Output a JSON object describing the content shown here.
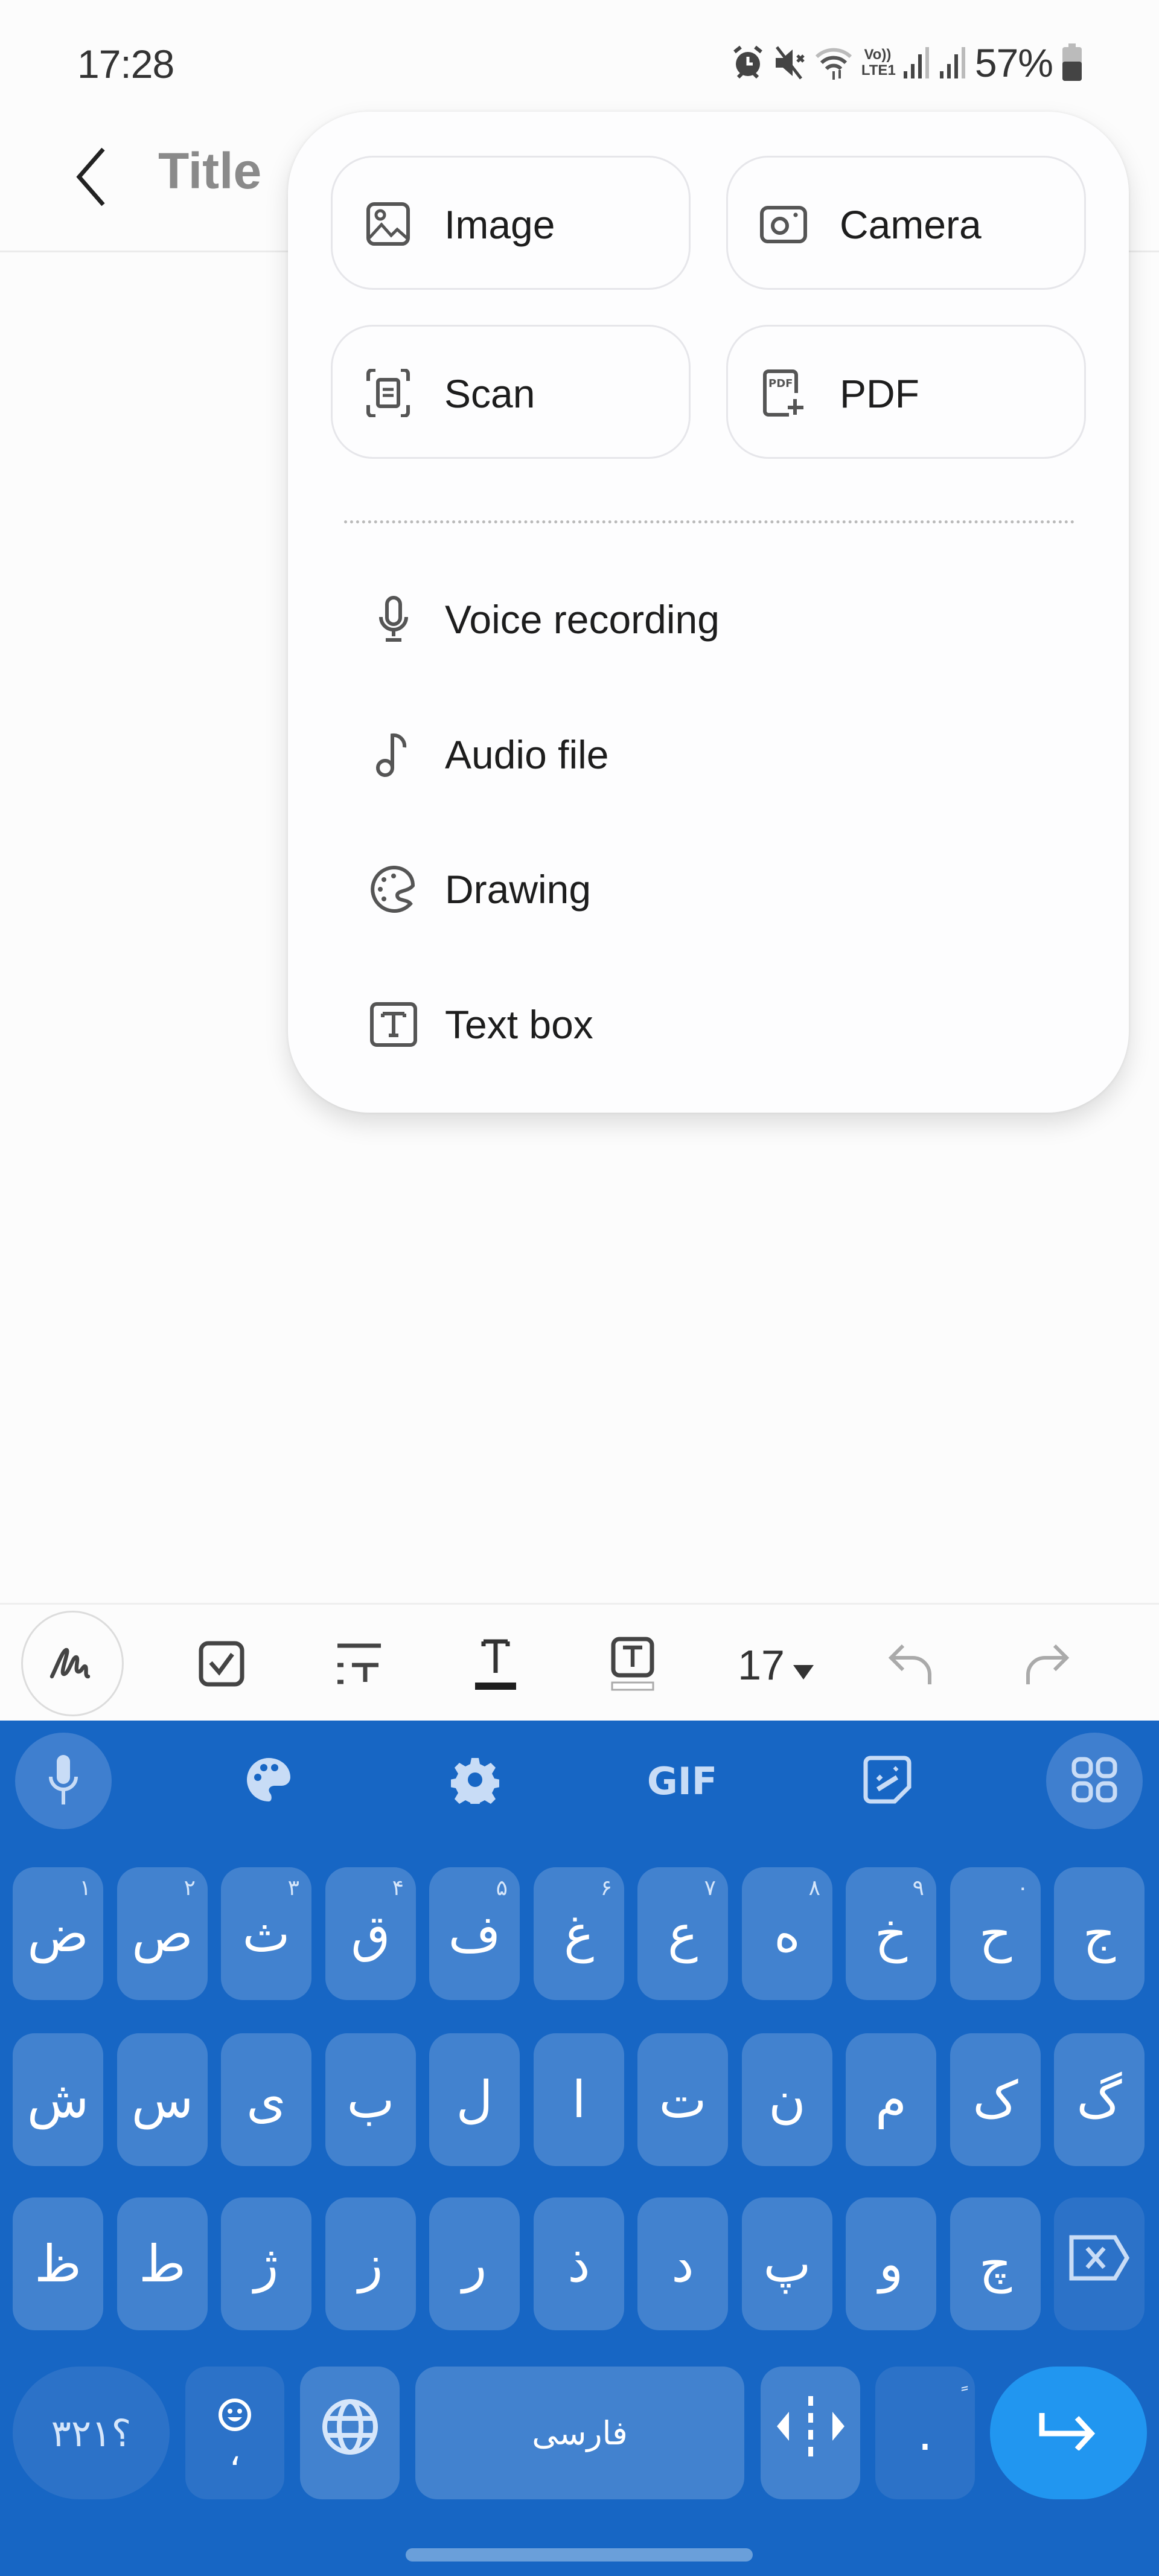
{
  "status_bar": {
    "time": "17:28",
    "icons": [
      "alarm-icon",
      "mute-icon",
      "wifi-icon",
      "volte-lte-icon",
      "signal-icon",
      "signal-icon"
    ],
    "volte_label": "Vo)) LTE1",
    "battery_percent": "57%",
    "battery_level": 0.57
  },
  "header": {
    "back_icon": "chevron-left-icon",
    "title_placeholder": "Title"
  },
  "insert_menu": {
    "grid": [
      {
        "label": "Image",
        "icon": "image-icon"
      },
      {
        "label": "Camera",
        "icon": "camera-icon"
      },
      {
        "label": "Scan",
        "icon": "scan-icon"
      },
      {
        "label": "PDF",
        "icon": "pdf-add-icon"
      }
    ],
    "list": [
      {
        "label": "Voice recording",
        "icon": "microphone-icon"
      },
      {
        "label": "Audio file",
        "icon": "music-note-icon"
      },
      {
        "label": "Drawing",
        "icon": "palette-icon"
      },
      {
        "label": "Text box",
        "icon": "text-box-icon"
      }
    ]
  },
  "editor_toolbar": {
    "items": [
      "handwriting-icon",
      "checkbox-icon",
      "paragraph-style-icon",
      "text-color-icon",
      "text-box-highlight-icon",
      "font-size-dropdown",
      "undo-icon",
      "redo-icon"
    ],
    "font_size": "17"
  },
  "keyboard": {
    "accent_color": "#1766c4",
    "key_color": "#4282cf",
    "enter_color": "#2196f0",
    "toolbar": [
      "microphone-icon",
      "palette-icon",
      "settings-icon",
      "gif-icon",
      "sticker-icon",
      "grid-menu-icon"
    ],
    "gif_label": "GIF",
    "row1": [
      {
        "char": "ض",
        "sup": "۱"
      },
      {
        "char": "ص",
        "sup": "۲"
      },
      {
        "char": "ث",
        "sup": "۳"
      },
      {
        "char": "ق",
        "sup": "۴"
      },
      {
        "char": "ف",
        "sup": "۵"
      },
      {
        "char": "غ",
        "sup": "۶"
      },
      {
        "char": "ع",
        "sup": "۷"
      },
      {
        "char": "ه",
        "sup": "۸"
      },
      {
        "char": "خ",
        "sup": "۹"
      },
      {
        "char": "ح",
        "sup": "۰"
      },
      {
        "char": "ج",
        "sup": ""
      }
    ],
    "row2": [
      "ش",
      "س",
      "ی",
      "ب",
      "ل",
      "ا",
      "ت",
      "ن",
      "م",
      "ک",
      "گ"
    ],
    "row3": [
      "ظ",
      "ط",
      "ژ",
      "ز",
      "ر",
      "ذ",
      "د",
      "پ",
      "و",
      "چ"
    ],
    "bottom": {
      "symbols_label": "؟۳۲۱",
      "comma_label": "،",
      "space_label": "فارسی",
      "period_label": ".",
      "period_sup": "ً"
    }
  }
}
